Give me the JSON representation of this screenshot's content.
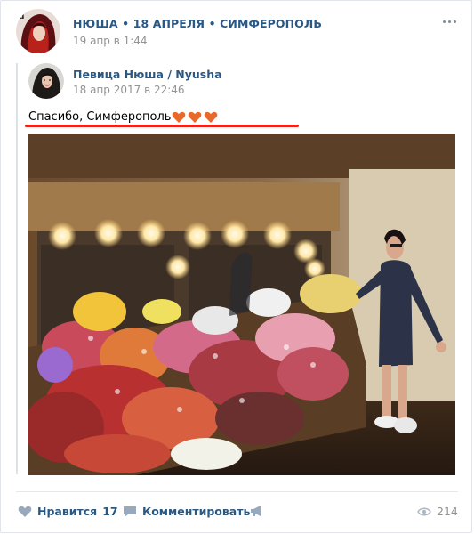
{
  "post": {
    "author": "НЮША • 18 АПРЕЛЯ • СИМФЕРОПОЛЬ",
    "date": "19 апр в 1:44"
  },
  "repost": {
    "author": "Певица Нюша / Nyusha",
    "date": "18 апр 2017 в 22:46",
    "text": "Спасибо, Симферополь",
    "emoji": "heart-emoji"
  },
  "footer": {
    "like_label": "Нравится",
    "like_count": "17",
    "comment_label": "Комментировать",
    "views_count": "214"
  },
  "colors": {
    "link": "#2a5885",
    "meta": "#939393",
    "underline": "#e8261b",
    "heart": "#e8692a"
  }
}
